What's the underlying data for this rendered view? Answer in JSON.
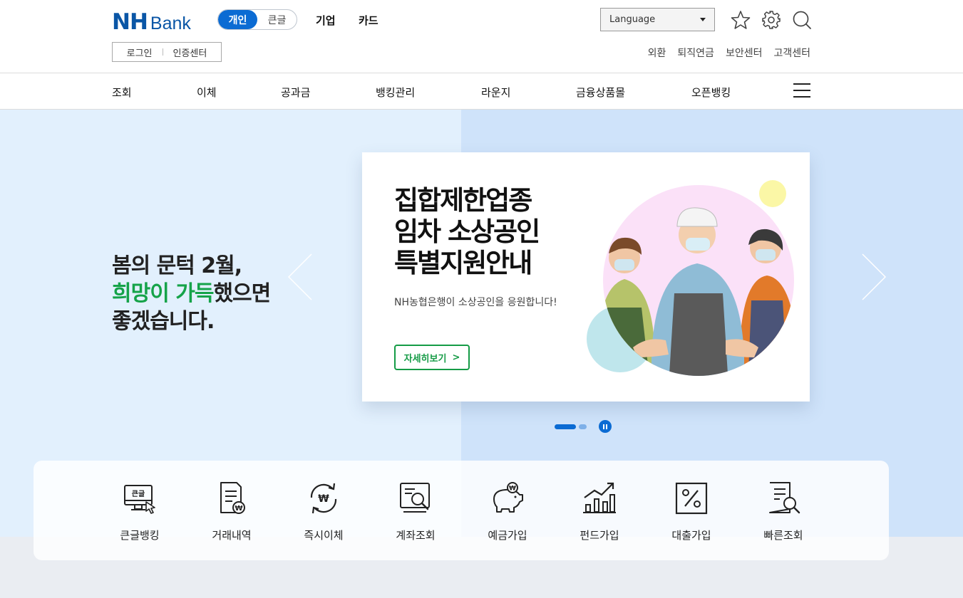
{
  "header": {
    "logo_nh": "NH",
    "logo_bank": "Bank",
    "mode_personal": "개인",
    "mode_bigfont": "큰글",
    "link_corporate": "기업",
    "link_card": "카드",
    "login": "로그인",
    "cert_center": "인증센터",
    "language": "Language",
    "util_links": [
      "외환",
      "퇴직연금",
      "보안센터",
      "고객센터"
    ]
  },
  "gnb": {
    "items": [
      "조회",
      "이체",
      "공과금",
      "뱅킹관리",
      "라운지",
      "금융상품몰",
      "오픈뱅킹"
    ]
  },
  "hero": {
    "line1": "봄의 문턱 2월,",
    "line2_green": "희망이 가득",
    "line2_rest": "했으면",
    "line3": "좋겠습니다.",
    "banner_title_1": "집합제한업종",
    "banner_title_2": "임차 소상공인",
    "banner_title_3": "특별지원안내",
    "banner_subtitle": "NH농협은행이 소상공인을 응원합니다!",
    "banner_button": "자세히보기",
    "banner_button_arrow": ">"
  },
  "quick_menu": {
    "items": [
      {
        "label": "큰글뱅킹",
        "icon": "bigfont-banking-icon"
      },
      {
        "label": "거래내역",
        "icon": "transaction-history-icon"
      },
      {
        "label": "즉시이체",
        "icon": "instant-transfer-icon"
      },
      {
        "label": "계좌조회",
        "icon": "account-inquiry-icon"
      },
      {
        "label": "예금가입",
        "icon": "piggy-bank-icon"
      },
      {
        "label": "펀드가입",
        "icon": "fund-chart-icon"
      },
      {
        "label": "대출가입",
        "icon": "loan-percent-icon"
      },
      {
        "label": "빠른조회",
        "icon": "quick-search-icon"
      }
    ],
    "bigfont_icon_text": "큰글",
    "won_symbol": "₩"
  },
  "colors": {
    "brand_blue": "#0b6bd3",
    "green": "#15a349",
    "hero_left": "#e2f0fd",
    "hero_right": "#cfe3fa"
  }
}
